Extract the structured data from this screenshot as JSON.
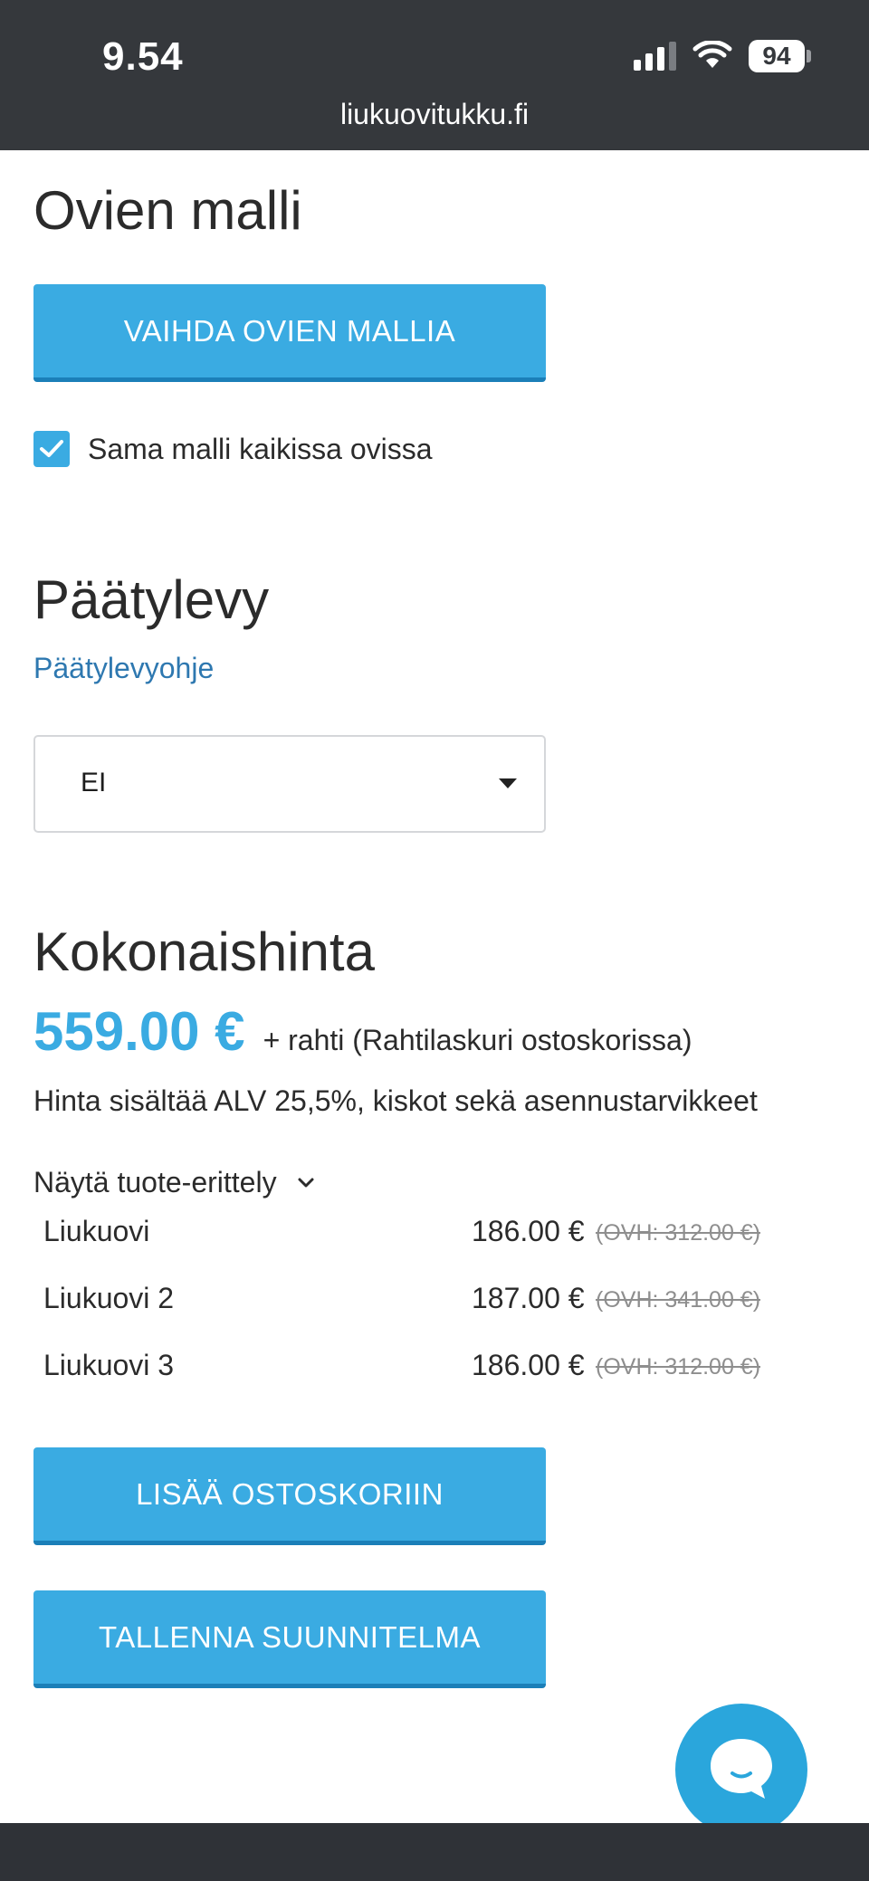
{
  "status_bar": {
    "time": "9.54",
    "battery": "94",
    "url": "liukuovitukku.fi"
  },
  "door_model": {
    "title": "Ovien malli",
    "change_button": "VAIHDA OVIEN MALLIA",
    "same_model_checkbox": {
      "label": "Sama malli kaikissa ovissa",
      "checked": true
    }
  },
  "end_panel": {
    "title": "Päätylevy",
    "guide_link": "Päätylevyohje",
    "select_value": "EI"
  },
  "total": {
    "title": "Kokonaishinta",
    "price": "559.00 €",
    "shipping_note": "+ rahti (Rahtilaskuri ostoskorissa)",
    "vat_note": "Hinta sisältää ALV 25,5%, kiskot sekä asennustarvikkeet",
    "breakdown_toggle": "Näytä tuote-erittely",
    "items": [
      {
        "name": "Liukuovi",
        "price": "186.00 €",
        "ovh": "(OVH: 312.00 €)"
      },
      {
        "name": "Liukuovi 2",
        "price": "187.00 €",
        "ovh": "(OVH: 341.00 €)"
      },
      {
        "name": "Liukuovi 3",
        "price": "186.00 €",
        "ovh": "(OVH: 312.00 €)"
      }
    ]
  },
  "actions": {
    "add_to_cart": "LISÄÄ OSTOSKORIIN",
    "save_plan": "TALLENNA SUUNNITELMA"
  },
  "colors": {
    "accent": "#3aabe2",
    "link": "#2e78b0",
    "status_bar": "#35383c"
  }
}
